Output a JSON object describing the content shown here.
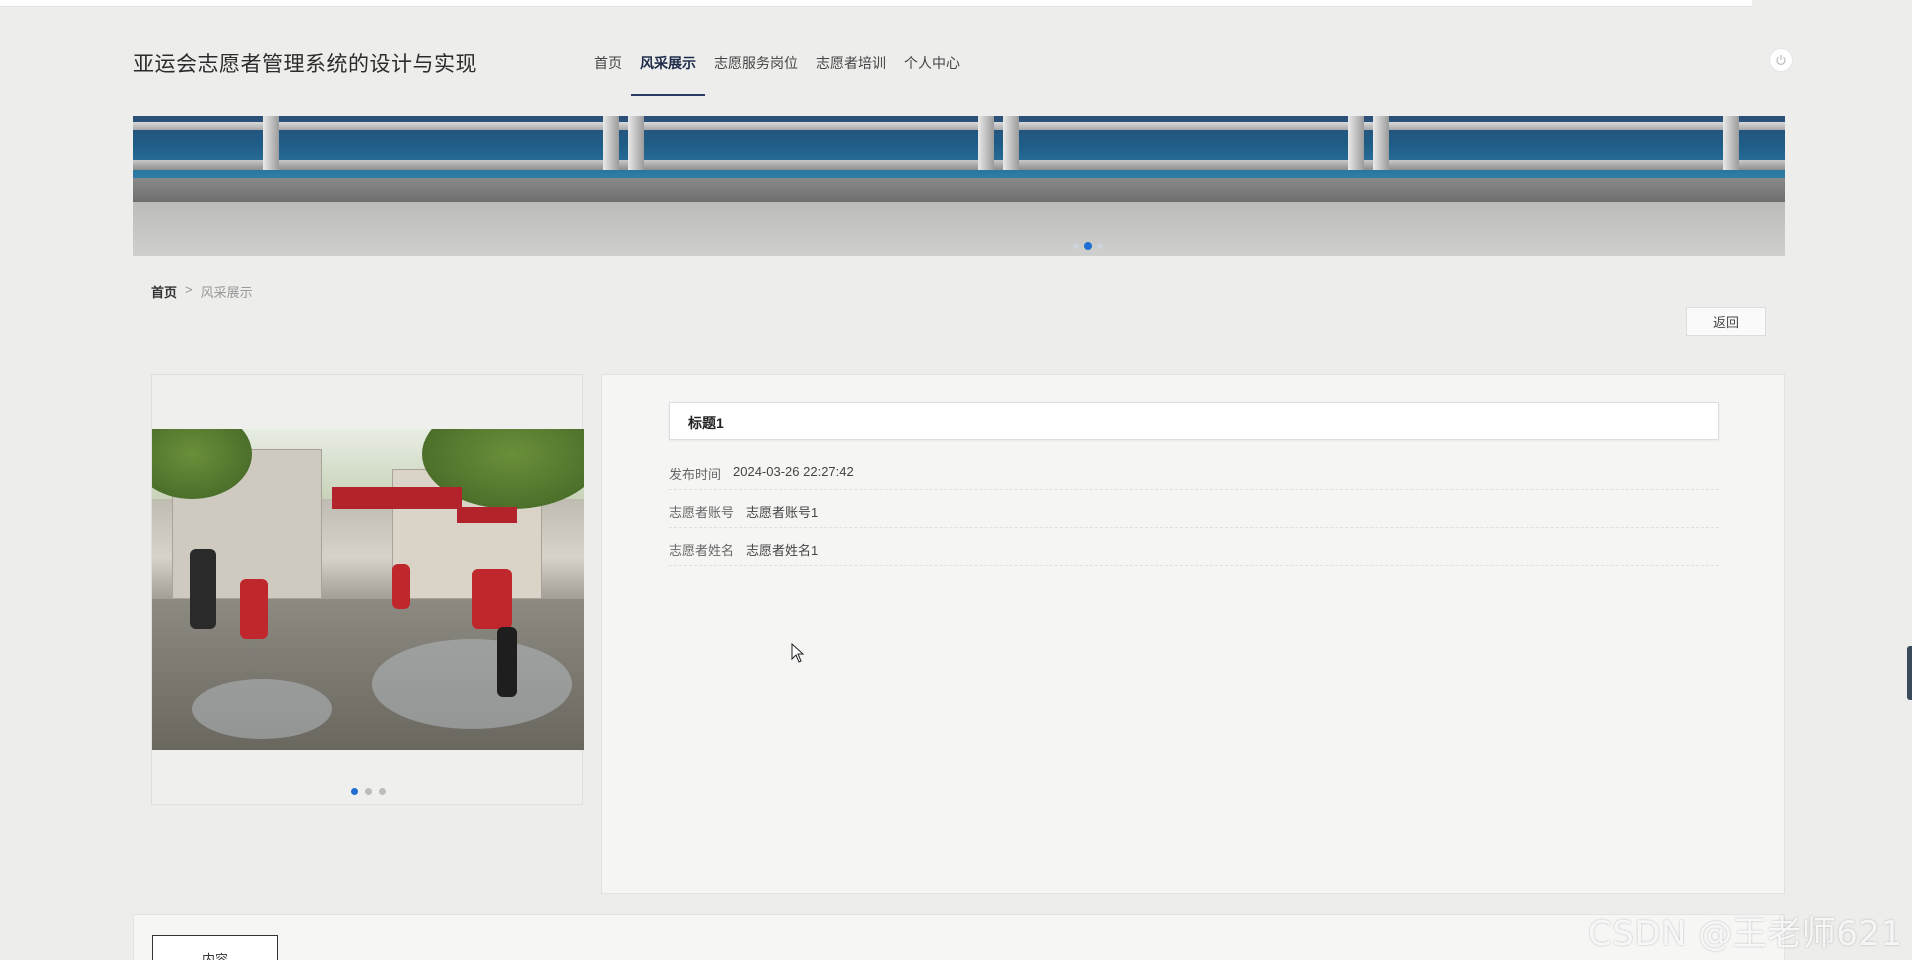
{
  "header": {
    "site_title": "亚运会志愿者管理系统的设计与实现",
    "nav": [
      {
        "label": "首页",
        "active": false
      },
      {
        "label": "风采展示",
        "active": true
      },
      {
        "label": "志愿服务岗位",
        "active": false
      },
      {
        "label": "志愿者培训",
        "active": false
      },
      {
        "label": "个人中心",
        "active": false
      }
    ],
    "power_icon": "power-icon"
  },
  "banner": {
    "slides": 3,
    "active_slide": 2
  },
  "breadcrumb": {
    "home": "首页",
    "separator": ">",
    "current": "风采展示"
  },
  "actions": {
    "back_label": "返回"
  },
  "gallery": {
    "slides": 3,
    "active_slide": 1
  },
  "detail": {
    "title": "标题1",
    "fields": [
      {
        "label": "发布时间",
        "value": "2024-03-26 22:27:42"
      },
      {
        "label": "志愿者账号",
        "value": "志愿者账号1"
      },
      {
        "label": "志愿者姓名",
        "value": "志愿者姓名1"
      }
    ]
  },
  "tabs": {
    "content_label": "内容"
  },
  "watermark": "CSDN @王老师621",
  "colors": {
    "accent": "#1e6fd1",
    "nav_active": "#2a3c63",
    "background": "#ededeb"
  }
}
